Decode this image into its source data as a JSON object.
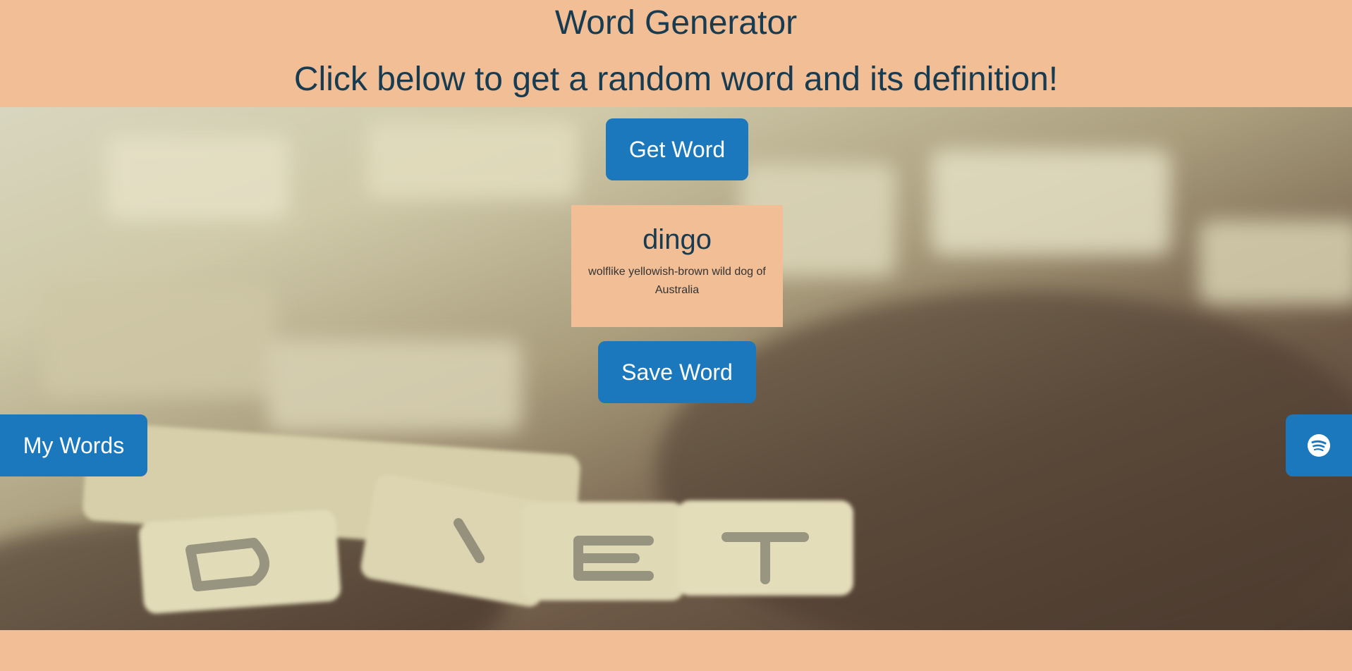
{
  "header": {
    "title": "Word Generator",
    "subtitle": "Click below to get a random word and its definition!"
  },
  "buttons": {
    "get_word": "Get Word",
    "save_word": "Save Word",
    "my_words": "My Words"
  },
  "word_card": {
    "word": "dingo",
    "definition": "wolflike yellowish-brown wild dog of Australia"
  },
  "icons": {
    "spotify": "spotify-icon"
  },
  "colors": {
    "background": "#f1be96",
    "heading_text": "#173b50",
    "button": "#1b78bd",
    "button_text": "#ffffff"
  }
}
